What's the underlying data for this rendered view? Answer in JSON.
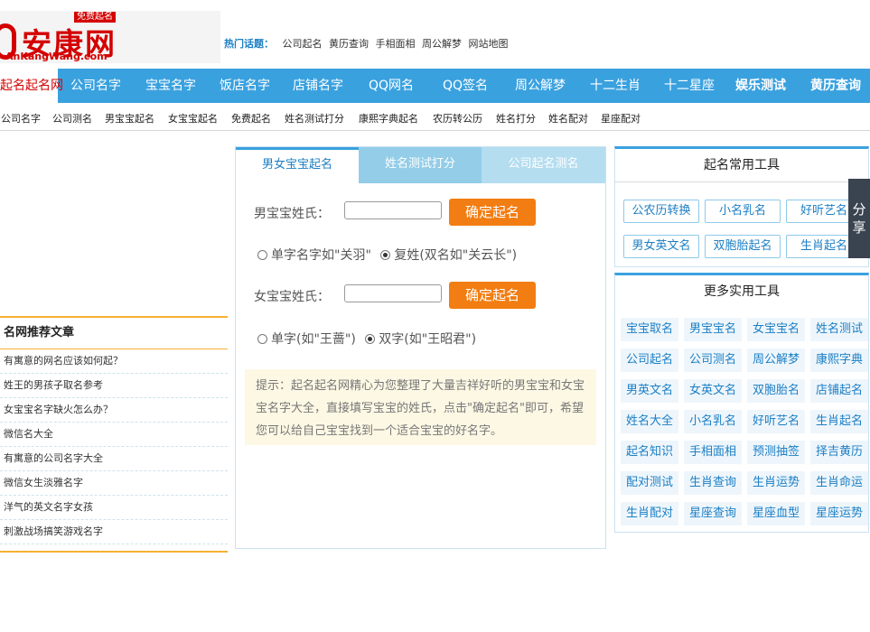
{
  "logo": {
    "title": "安康网",
    "badge": "免费起名",
    "domain": "AnKangWang.com"
  },
  "hot_topics": {
    "label": "热门话题：",
    "links": [
      "公司起名",
      "黄历查询",
      "手相面相",
      "周公解梦",
      "网站地图"
    ]
  },
  "main_nav": [
    {
      "label": "起名起名网",
      "active": true
    },
    {
      "label": "公司名字"
    },
    {
      "label": "宝宝名字"
    },
    {
      "label": "饭店名字"
    },
    {
      "label": "店铺名字"
    },
    {
      "label": "QQ网名"
    },
    {
      "label": "QQ签名"
    },
    {
      "label": "周公解梦"
    },
    {
      "label": "十二生肖"
    },
    {
      "label": "十二星座"
    },
    {
      "label": "娱乐测试"
    },
    {
      "label": "黄历查询"
    }
  ],
  "sub_nav": [
    "公司名字",
    "公司测名",
    "男宝宝起名",
    "女宝宝起名",
    "免费起名",
    "姓名测试打分",
    "康熙字典起名",
    "农历转公历",
    "姓名打分",
    "姓名配对",
    "星座配对"
  ],
  "articles": {
    "title": "名网推荐文章",
    "items": [
      "有寓意的网名应该如何起？",
      "姓王的男孩子取名参考",
      "女宝宝名字缺火怎么办？",
      "微信名大全",
      "有寓意的公司名字大全",
      "微信女生淡雅名字",
      "洋气的英文名字女孩",
      "刺激战场搞笑游戏名字"
    ]
  },
  "form": {
    "tabs": [
      "男女宝宝起名",
      "姓名测试打分",
      "公司起名测名"
    ],
    "boy_label": "男宝宝姓氏：",
    "girl_label": "女宝宝姓氏：",
    "boy_value": "",
    "girl_value": "",
    "submit_label": "确定起名",
    "boy_options": [
      "单字名字如\"关羽\"",
      "复姓(双名如\"关云长\")"
    ],
    "girl_options": [
      "单字(如\"王蔷\")",
      "双字(如\"王昭君\")"
    ],
    "tip": "提示：起名起名网精心为您整理了大量吉祥好听的男宝宝和女宝宝名字大全，直接填写宝宝的姓氏，点击\"确定起名\"即可，希望您可以给自己宝宝找到一个适合宝宝的好名字。"
  },
  "common_tools": {
    "title": "起名常用工具",
    "items": [
      "公农历转换",
      "小名乳名",
      "好听艺名",
      "男女英文名",
      "双胞胎起名",
      "生肖起名"
    ]
  },
  "more_tools": {
    "title": "更多实用工具",
    "items": [
      "宝宝取名",
      "男宝宝名",
      "女宝宝名",
      "姓名测试",
      "公司起名",
      "公司测名",
      "周公解梦",
      "康熙字典",
      "男英文名",
      "女英文名",
      "双胞胎名",
      "店铺起名",
      "姓名大全",
      "小名乳名",
      "好听艺名",
      "生肖起名",
      "起名知识",
      "手相面相",
      "预测抽签",
      "择吉黄历",
      "配对测试",
      "生肖查询",
      "生肖运势",
      "生肖命运",
      "生肖配对",
      "星座查询",
      "星座血型",
      "星座运势"
    ]
  },
  "share": {
    "label": "分享"
  }
}
